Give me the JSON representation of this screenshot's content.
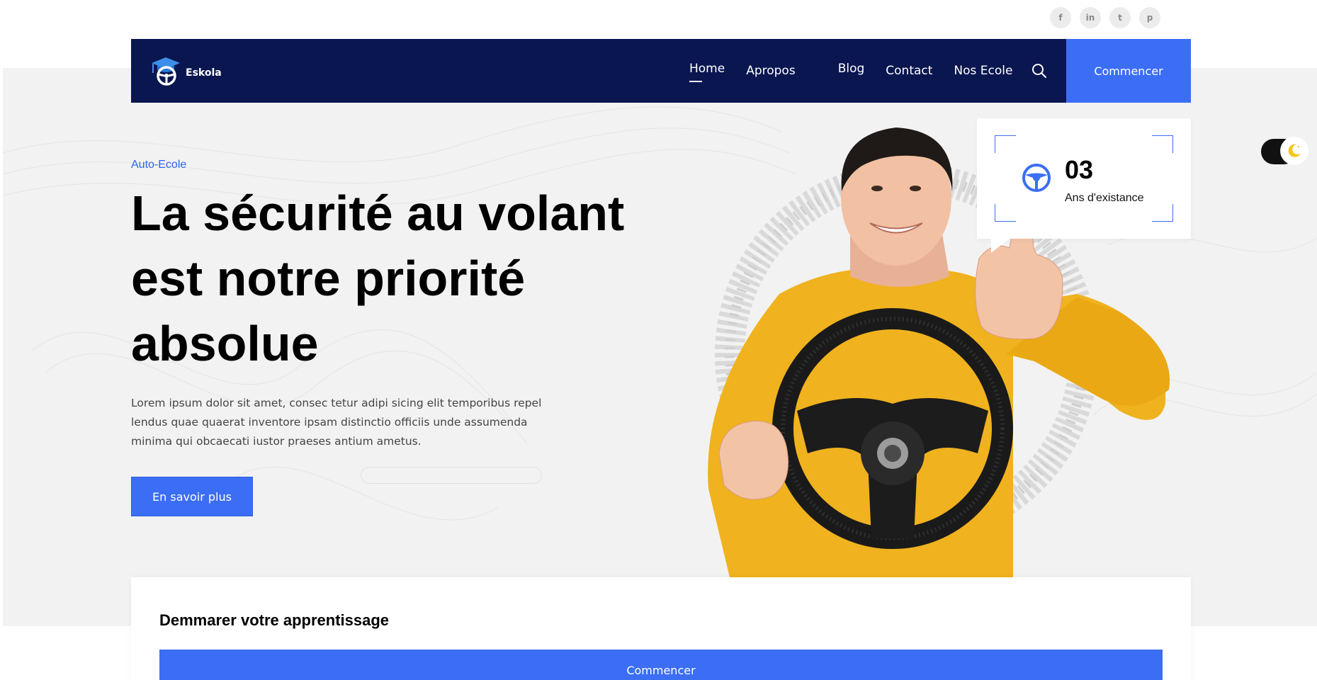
{
  "social": [
    {
      "name": "facebook",
      "glyph": "f"
    },
    {
      "name": "linkedin",
      "glyph": "in"
    },
    {
      "name": "twitter",
      "glyph": "t"
    },
    {
      "name": "pinterest",
      "glyph": "p"
    }
  ],
  "brand": {
    "name": "Eskola",
    "icon": "graduation-cap-steering-wheel",
    "color": "#3b6ef5"
  },
  "nav": {
    "items": [
      {
        "label": "Home",
        "active": true
      },
      {
        "label": "Apropos",
        "active": false
      },
      {
        "label": "Blog",
        "active": false
      },
      {
        "label": "Contact",
        "active": false
      },
      {
        "label": "Nos Ecole",
        "active": false
      }
    ],
    "search_icon": "search-icon",
    "cta_label": "Commencer",
    "background": "#0a1650"
  },
  "hero": {
    "eyebrow": "Auto-Ecole",
    "title_line1": "La sécurité au volant",
    "title_line2": "est notre priorité",
    "title_line3": "absolue",
    "description": "Lorem ipsum dolor sit amet, consec tetur adipi sicing elit temporibus repel lendus quae quaerat inventore ipsam distinctio officiis unde assumenda minima qui obcaecati iustor praeses antium ametus.",
    "cta_label": "En savoir plus"
  },
  "stat": {
    "value": "03",
    "label": "Ans d'existance",
    "icon": "steering-wheel-icon"
  },
  "theme_toggle": {
    "icon": "moon-icon",
    "mode": "dark"
  },
  "start_card": {
    "title": "Demmarer votre apprentissage",
    "cta_label": "Commencer"
  },
  "colors": {
    "accent": "#3b6ef5",
    "navy": "#0a1650",
    "hero_bg": "#f2f2f2",
    "shirt": "#f0b21e"
  }
}
